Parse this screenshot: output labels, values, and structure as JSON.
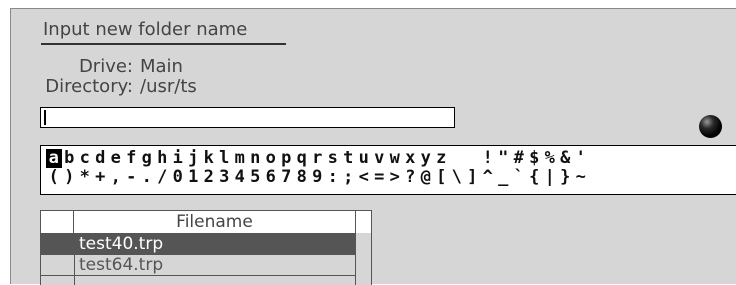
{
  "dialog": {
    "title": "Input new folder name",
    "drive_label": "Drive:",
    "drive_value": "Main",
    "directory_label": "Directory:",
    "directory_value": "/usr/ts"
  },
  "name_input": {
    "value": ""
  },
  "status_indicator": {
    "icon": "black-ball-icon"
  },
  "char_palette": {
    "selected": "a",
    "row1": [
      "a",
      "b",
      "c",
      "d",
      "e",
      "f",
      "g",
      "h",
      "i",
      "j",
      "k",
      "l",
      "m",
      "n",
      "o",
      "p",
      "q",
      "r",
      "s",
      "t",
      "u",
      "v",
      "w",
      "x",
      "y",
      "z",
      " ",
      " ",
      "!",
      "\"",
      "#",
      "$",
      "%",
      "&",
      "'"
    ],
    "row2": [
      "(",
      ")",
      "*",
      "+",
      ",",
      "-",
      ".",
      "/",
      "0",
      "1",
      "2",
      "3",
      "4",
      "5",
      "6",
      "7",
      "8",
      "9",
      ":",
      ";",
      "<",
      "=",
      ">",
      "?",
      "@",
      "[",
      "\\",
      "]",
      "^",
      "_",
      "`",
      "{",
      "|",
      "}",
      "~"
    ]
  },
  "file_list": {
    "header": "Filename",
    "rows": [
      {
        "name": "test40.trp",
        "selected": true
      },
      {
        "name": "test64.trp",
        "selected": false
      }
    ]
  },
  "colors": {
    "panel_background": "#d6d6d6",
    "selection": "#555555",
    "text": "#444444"
  }
}
